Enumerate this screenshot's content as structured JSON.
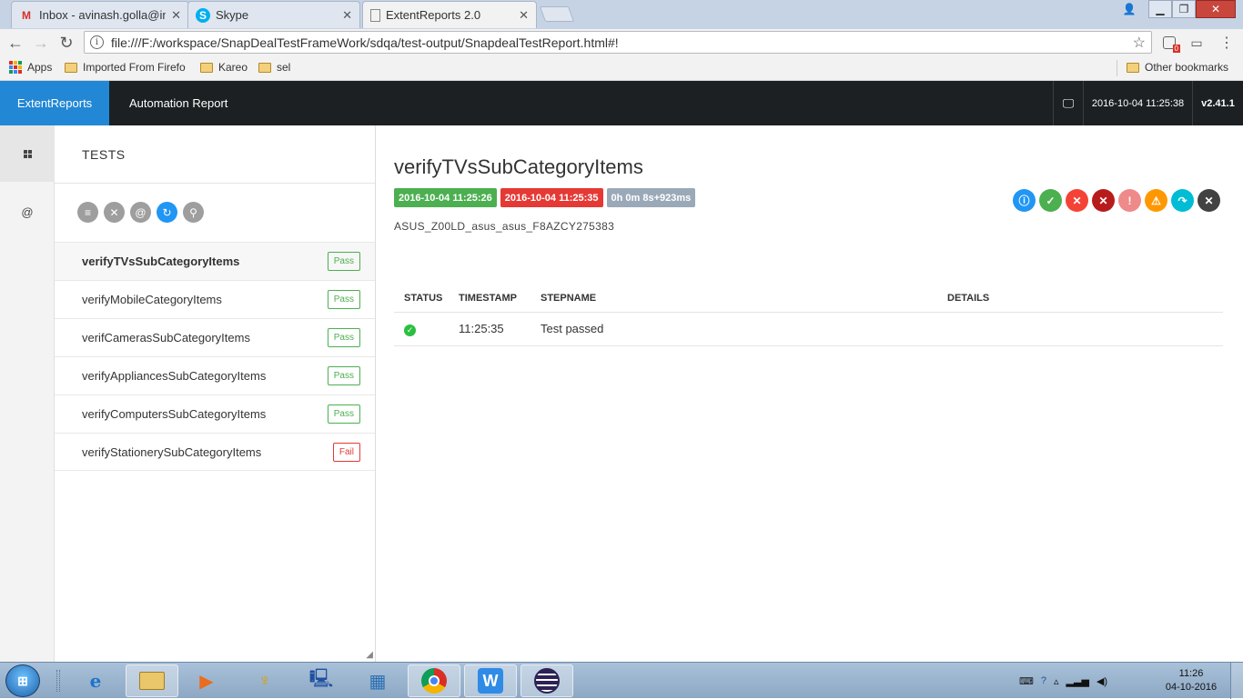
{
  "browser": {
    "tabs": [
      {
        "title": "Inbox - avinash.golla@im",
        "icon": "gmail-icon"
      },
      {
        "title": "Skype",
        "icon": "skype-icon"
      },
      {
        "title": "ExtentReports 2.0",
        "icon": "page-icon"
      }
    ],
    "url": "file:///F:/workspace/SnapDealTestFrameWork/sdqa/test-output/SnapdealTestReport.html#!",
    "extension_badge": "0",
    "bookmarks": [
      "Apps",
      "Imported From Firefo",
      "Kareo",
      "sel"
    ],
    "other_bookmarks": "Other bookmarks"
  },
  "header": {
    "brand": "ExtentReports",
    "title": "Automation Report",
    "timestamp": "2016-10-04 11:25:38",
    "version": "v2.41.1"
  },
  "tests_panel": {
    "heading": "TESTS",
    "tests": [
      {
        "name": "verifyTVsSubCategoryItems",
        "status": "Pass"
      },
      {
        "name": "verifyMobileCategoryItems",
        "status": "Pass"
      },
      {
        "name": "verifCamerasSubCategoryItems",
        "status": "Pass"
      },
      {
        "name": "verifyAppliancesSubCategoryItems",
        "status": "Pass"
      },
      {
        "name": "verifyComputersSubCategoryItems",
        "status": "Pass"
      },
      {
        "name": "verifyStationerySubCategoryItems",
        "status": "Fail"
      }
    ]
  },
  "detail": {
    "title": "verifyTVsSubCategoryItems",
    "start_time": "2016-10-04 11:25:26",
    "end_time": "2016-10-04 11:25:35",
    "duration": "0h 0m 8s+923ms",
    "device": "ASUS_Z00LD_asus_asus_F8AZCY275383",
    "columns": [
      "STATUS",
      "TIMESTAMP",
      "STEPNAME",
      "DETAILS"
    ],
    "steps": [
      {
        "status": "pass",
        "timestamp": "11:25:35",
        "stepname": "Test passed",
        "details": ""
      }
    ]
  },
  "colors": {
    "brand_blue": "#2287d4",
    "header_dark": "#1c2022",
    "pass_green": "#4caf50",
    "fail_red": "#e53935",
    "start_tag": "#4caf50",
    "end_tag": "#e53935",
    "duration_tag": "#9aa9b8"
  },
  "taskbar": {
    "time": "11:26",
    "date": "04-10-2016"
  }
}
